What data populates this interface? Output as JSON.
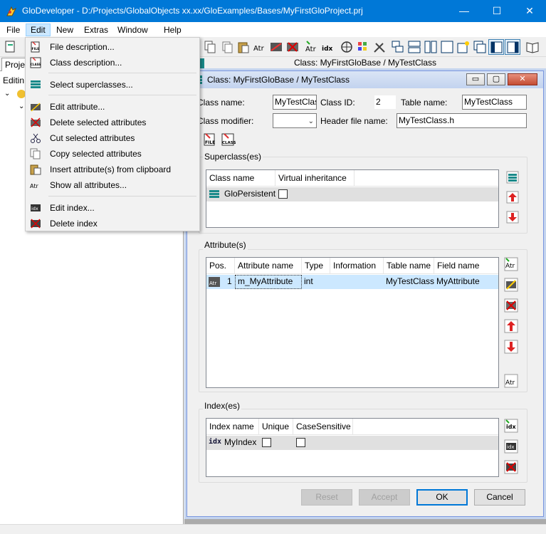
{
  "window": {
    "title": "GloDeveloper - D:/Projects/GlobalObjects xx.xx/GloExamples/Bases/MyFirstGloProject.prj",
    "minimize": "—",
    "maximize": "☐",
    "close": "✕"
  },
  "menubar": {
    "items": [
      "File",
      "Edit",
      "New",
      "Extras",
      "Window",
      "Help"
    ],
    "active": "Edit"
  },
  "edit_menu": {
    "items": [
      {
        "label": "File description...",
        "icon": "file-description-icon"
      },
      {
        "label": "Class description...",
        "icon": "class-description-icon"
      },
      {
        "label": "Select superclasses...",
        "icon": "superclass-icon"
      },
      {
        "label": "Edit attribute...",
        "icon": "edit-attribute-icon"
      },
      {
        "label": "Delete selected attributes",
        "icon": "delete-attribute-icon"
      },
      {
        "label": "Cut selected attributes",
        "icon": "scissors-icon"
      },
      {
        "label": "Copy selected attributes",
        "icon": "copy-icon"
      },
      {
        "label": "Insert attribute(s) from clipboard",
        "icon": "paste-icon"
      },
      {
        "label": "Show all attributes...",
        "icon": "show-attributes-icon"
      },
      {
        "label": "Edit index...",
        "icon": "edit-index-icon"
      },
      {
        "label": "Delete index",
        "icon": "delete-index-icon"
      }
    ]
  },
  "left_pane": {
    "tab": "Projec",
    "editing": "Editin"
  },
  "workspace": {
    "caption": "Class: MyFirstGloBase / MyTestClass"
  },
  "child": {
    "title": "Class: MyFirstGloBase / MyTestClass",
    "minimize": "▭",
    "maximize": "▢",
    "close": "✕",
    "class_name_label": "Class name:",
    "class_name_value": "MyTestClass",
    "class_id_label": "Class ID:",
    "class_id_value": "2",
    "table_name_label": "Table name:",
    "table_name_value": "MyTestClass",
    "class_modifier_label": "Class modifier:",
    "class_modifier_value": "",
    "header_file_label": "Header file name:",
    "header_file_value": "MyTestClass.h",
    "superclass_group": "Superclass(es)",
    "superclass_headers": [
      "Class name",
      "Virtual inheritance"
    ],
    "superclass_rows": [
      {
        "name": "GloPersistent",
        "virtual": false
      }
    ],
    "attributes_group": "Attribute(s)",
    "attribute_headers": [
      "Pos.",
      "Attribute name",
      "Type",
      "Information",
      "Table name",
      "Field name"
    ],
    "attribute_rows": [
      {
        "pos": "1",
        "name": "m_MyAttribute",
        "type": "int",
        "info": "",
        "table": "MyTestClass",
        "field": "MyAttribute"
      }
    ],
    "index_group": "Index(es)",
    "index_headers": [
      "Index name",
      "Unique",
      "CaseSensitive"
    ],
    "index_rows": [
      {
        "name": "MyIndex",
        "unique": false,
        "case": false
      }
    ],
    "reset": "Reset",
    "accept": "Accept",
    "ok": "OK",
    "cancel": "Cancel"
  },
  "colors": {
    "titlebar": "#0078d7",
    "selection": "#cce8ff",
    "row_highlight": "#cce8ff"
  }
}
